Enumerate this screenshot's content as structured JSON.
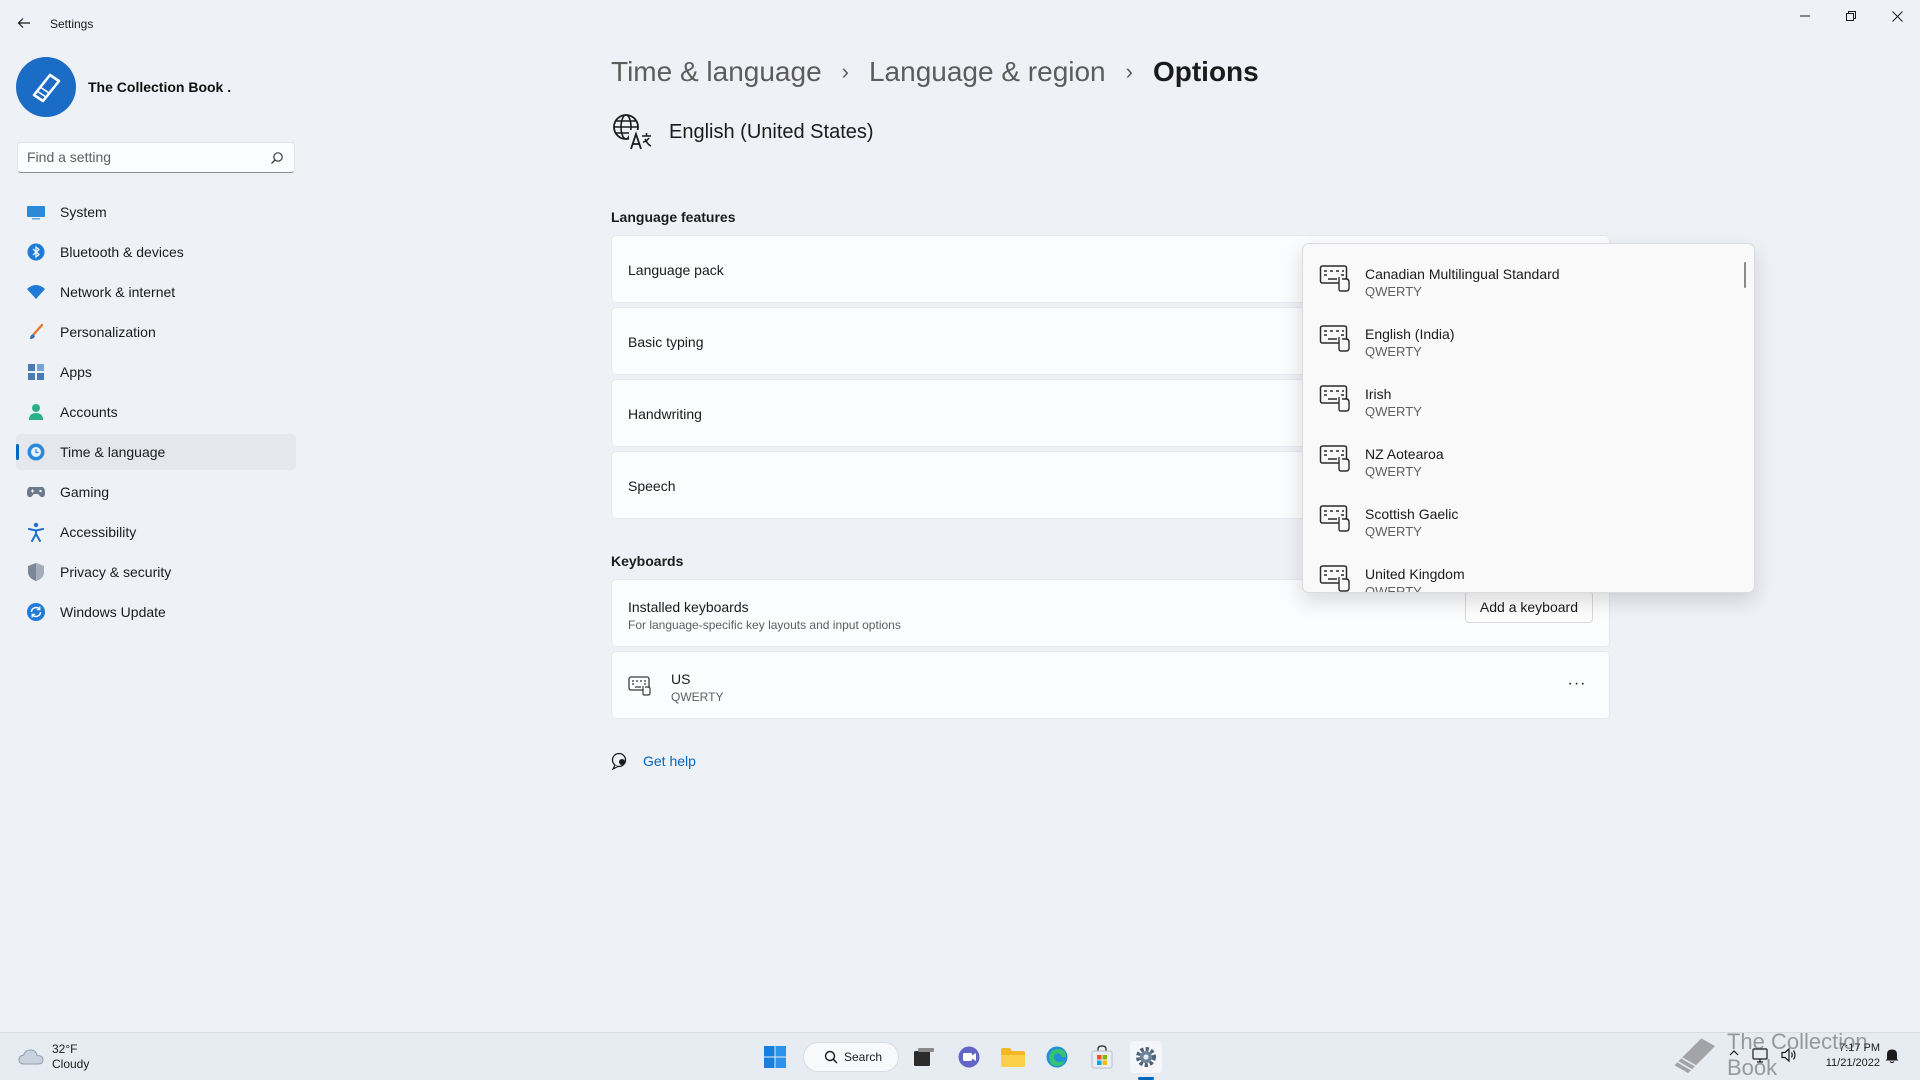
{
  "window": {
    "title": "Settings"
  },
  "profile": {
    "name": "The Collection Book ."
  },
  "search": {
    "placeholder": "Find a setting"
  },
  "nav": {
    "items": [
      {
        "label": "System",
        "icon": "monitor-icon"
      },
      {
        "label": "Bluetooth & devices",
        "icon": "bluetooth-icon"
      },
      {
        "label": "Network & internet",
        "icon": "wifi-icon"
      },
      {
        "label": "Personalization",
        "icon": "brush-icon"
      },
      {
        "label": "Apps",
        "icon": "apps-icon"
      },
      {
        "label": "Accounts",
        "icon": "person-icon"
      },
      {
        "label": "Time & language",
        "icon": "globe-clock-icon",
        "active": true
      },
      {
        "label": "Gaming",
        "icon": "gamepad-icon"
      },
      {
        "label": "Accessibility",
        "icon": "accessibility-icon"
      },
      {
        "label": "Privacy & security",
        "icon": "shield-icon"
      },
      {
        "label": "Windows Update",
        "icon": "update-icon"
      }
    ]
  },
  "breadcrumb": {
    "items": [
      "Time & language",
      "Language & region"
    ],
    "current": "Options",
    "separator": "›"
  },
  "language": {
    "name": "English (United States)"
  },
  "features": {
    "title": "Language features",
    "items": [
      "Language pack",
      "Basic typing",
      "Handwriting",
      "Speech"
    ]
  },
  "keyboards": {
    "title": "Keyboards",
    "installed_label": "Installed keyboards",
    "installed_sub": "For language-specific key layouts and input options",
    "add_button": "Add a keyboard",
    "installed": [
      {
        "name": "US",
        "layout": "QWERTY"
      }
    ],
    "more_label": "···"
  },
  "flyout": {
    "options": [
      {
        "name": "Canadian Multilingual Standard",
        "layout": "QWERTY"
      },
      {
        "name": "English (India)",
        "layout": "QWERTY"
      },
      {
        "name": "Irish",
        "layout": "QWERTY"
      },
      {
        "name": "NZ Aotearoa",
        "layout": "QWERTY"
      },
      {
        "name": "Scottish Gaelic",
        "layout": "QWERTY"
      },
      {
        "name": "United Kingdom",
        "layout": "QWERTY"
      }
    ]
  },
  "help": {
    "label": "Get help"
  },
  "taskbar": {
    "weather_temp": "32°F",
    "weather_desc": "Cloudy",
    "search_label": "Search",
    "time": "7:17 PM",
    "date": "11/21/2022",
    "watermark": "The Collection Book"
  },
  "colors": {
    "accent": "#0067c0",
    "background": "#eef1f6",
    "card": "#fbfcfd"
  }
}
